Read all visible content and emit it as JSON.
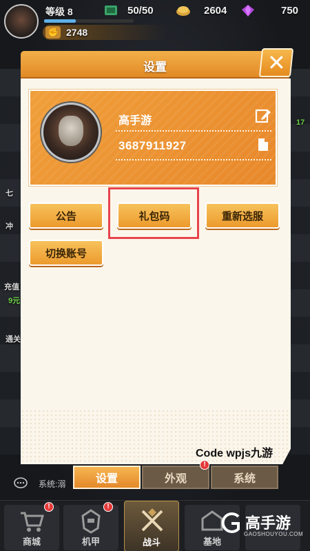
{
  "hud": {
    "level": "等级 8",
    "energy": "50/50",
    "gold": "2604",
    "gems": "750",
    "power": "2748"
  },
  "side_labels": {
    "left_1": "七",
    "left_2": "冲",
    "left_3": "充值",
    "left_4": "9元",
    "left_5": "通关",
    "right_1": "17"
  },
  "dialog": {
    "title": "设置",
    "profile": {
      "name": "高手游",
      "uid": "3687911927"
    },
    "buttons": {
      "announcement": "公告",
      "gift_code": "礼包码",
      "reselect_server": "重新选服",
      "switch_account": "切换账号"
    },
    "code_text": "Code wpjs九游"
  },
  "tabs": {
    "settings": "设置",
    "appearance": "外观",
    "system": "系统",
    "appearance_badge": "!"
  },
  "chat": {
    "system_msg": "系统:溺"
  },
  "nav": {
    "shop": "商城",
    "mecha": "机甲",
    "battle": "战斗",
    "guild": "基地",
    "fifth": ""
  },
  "watermark": {
    "title": "高手游",
    "subtitle": "GAOSHOUYOU.COM"
  },
  "colors": {
    "accent_orange": "#ec9a2d",
    "highlight_red": "#e8424c",
    "badge_red": "#e53939"
  }
}
